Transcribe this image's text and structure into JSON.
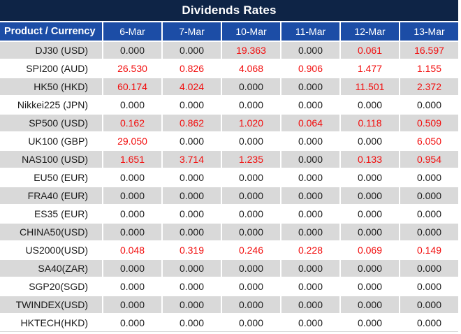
{
  "colors": {
    "title_bg": "#0e2446",
    "header_bg": "#1c4da6",
    "header_text": "#ffffff",
    "row_alt_bg": "#d9d9d9",
    "row_bg": "#ffffff",
    "value_text": "#1a1a1a",
    "value_highlight": "#f20d0d"
  },
  "chart_data": {
    "type": "table",
    "title": "Dividends Rates",
    "columns": [
      "Product / Currency",
      "6-Mar",
      "7-Mar",
      "10-Mar",
      "11-Mar",
      "12-Mar",
      "13-Mar"
    ],
    "rows": [
      {
        "product": "DJ30 (USD)",
        "values": [
          "0.000",
          "0.000",
          "19.363",
          "0.000",
          "0.061",
          "16.597"
        ],
        "red": [
          false,
          false,
          true,
          false,
          true,
          true
        ]
      },
      {
        "product": "SPI200 (AUD)",
        "values": [
          "26.530",
          "0.826",
          "4.068",
          "0.906",
          "1.477",
          "1.155"
        ],
        "red": [
          true,
          true,
          true,
          true,
          true,
          true
        ]
      },
      {
        "product": "HK50 (HKD)",
        "values": [
          "60.174",
          "4.024",
          "0.000",
          "0.000",
          "11.501",
          "2.372"
        ],
        "red": [
          true,
          true,
          false,
          false,
          true,
          true
        ]
      },
      {
        "product": "Nikkei225 (JPN)",
        "values": [
          "0.000",
          "0.000",
          "0.000",
          "0.000",
          "0.000",
          "0.000"
        ],
        "red": [
          false,
          false,
          false,
          false,
          false,
          false
        ]
      },
      {
        "product": "SP500 (USD)",
        "values": [
          "0.162",
          "0.862",
          "1.020",
          "0.064",
          "0.118",
          "0.509"
        ],
        "red": [
          true,
          true,
          true,
          true,
          true,
          true
        ]
      },
      {
        "product": "UK100 (GBP)",
        "values": [
          "29.050",
          "0.000",
          "0.000",
          "0.000",
          "0.000",
          "6.050"
        ],
        "red": [
          true,
          false,
          false,
          false,
          false,
          true
        ]
      },
      {
        "product": "NAS100 (USD)",
        "values": [
          "1.651",
          "3.714",
          "1.235",
          "0.000",
          "0.133",
          "0.954"
        ],
        "red": [
          true,
          true,
          true,
          false,
          true,
          true
        ]
      },
      {
        "product": "EU50 (EUR)",
        "values": [
          "0.000",
          "0.000",
          "0.000",
          "0.000",
          "0.000",
          "0.000"
        ],
        "red": [
          false,
          false,
          false,
          false,
          false,
          false
        ]
      },
      {
        "product": "FRA40 (EUR)",
        "values": [
          "0.000",
          "0.000",
          "0.000",
          "0.000",
          "0.000",
          "0.000"
        ],
        "red": [
          false,
          false,
          false,
          false,
          false,
          false
        ]
      },
      {
        "product": "ES35 (EUR)",
        "values": [
          "0.000",
          "0.000",
          "0.000",
          "0.000",
          "0.000",
          "0.000"
        ],
        "red": [
          false,
          false,
          false,
          false,
          false,
          false
        ]
      },
      {
        "product": "CHINA50(USD)",
        "values": [
          "0.000",
          "0.000",
          "0.000",
          "0.000",
          "0.000",
          "0.000"
        ],
        "red": [
          false,
          false,
          false,
          false,
          false,
          false
        ]
      },
      {
        "product": "US2000(USD)",
        "values": [
          "0.048",
          "0.319",
          "0.246",
          "0.228",
          "0.069",
          "0.149"
        ],
        "red": [
          true,
          true,
          true,
          true,
          true,
          true
        ]
      },
      {
        "product": "SA40(ZAR)",
        "values": [
          "0.000",
          "0.000",
          "0.000",
          "0.000",
          "0.000",
          "0.000"
        ],
        "red": [
          false,
          false,
          false,
          false,
          false,
          false
        ]
      },
      {
        "product": "SGP20(SGD)",
        "values": [
          "0.000",
          "0.000",
          "0.000",
          "0.000",
          "0.000",
          "0.000"
        ],
        "red": [
          false,
          false,
          false,
          false,
          false,
          false
        ]
      },
      {
        "product": "TWINDEX(USD)",
        "values": [
          "0.000",
          "0.000",
          "0.000",
          "0.000",
          "0.000",
          "0.000"
        ],
        "red": [
          false,
          false,
          false,
          false,
          false,
          false
        ]
      },
      {
        "product": "HKTECH(HKD)",
        "values": [
          "0.000",
          "0.000",
          "0.000",
          "0.000",
          "0.000",
          "0.000"
        ],
        "red": [
          false,
          false,
          false,
          false,
          false,
          false
        ]
      }
    ]
  }
}
